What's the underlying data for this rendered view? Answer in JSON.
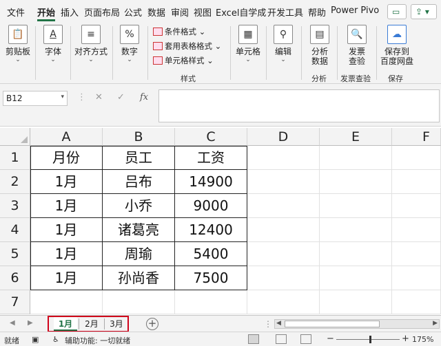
{
  "ribbon_tabs": [
    "文件",
    "开始",
    "插入",
    "页面布局",
    "公式",
    "数据",
    "审阅",
    "视图",
    "Excel自学成",
    "开发工具",
    "帮助",
    "Power Pivo"
  ],
  "active_tab": "开始",
  "ribbon": {
    "paste": "剪贴板",
    "font": "字体",
    "align": "对齐方式",
    "number": "数字",
    "cond_format": "条件格式",
    "table_format": "套用表格格式",
    "cell_style": "单元格样式",
    "styles_group": "样式",
    "cells": "单元格",
    "edit": "编辑",
    "analyze": "分析",
    "analyze2": "数据",
    "analyze_group": "分析",
    "invoice": "发票",
    "invoice2": "查验",
    "invoice_group": "发票查验",
    "save": "保存到",
    "save2": "百度网盘",
    "save_group": "保存",
    "icon_paste": "clipboard-icon",
    "icon_font": "A",
    "icon_number": "%",
    "icon_fx": "fx"
  },
  "formula_bar": {
    "name_box": "B12",
    "formula": ""
  },
  "columns": [
    "A",
    "B",
    "C",
    "D",
    "E",
    "F"
  ],
  "rows": [
    "1",
    "2",
    "3",
    "4",
    "5",
    "6",
    "7"
  ],
  "table": {
    "headers": [
      "月份",
      "员工",
      "工资"
    ],
    "data": [
      [
        "1月",
        "吕布",
        "14900"
      ],
      [
        "1月",
        "小乔",
        "9000"
      ],
      [
        "1月",
        "诸葛亮",
        "12400"
      ],
      [
        "1月",
        "周瑜",
        "5400"
      ],
      [
        "1月",
        "孙尚香",
        "7500"
      ]
    ]
  },
  "sheets": [
    "1月",
    "2月",
    "3月"
  ],
  "active_sheet": "1月",
  "status": {
    "ready": "就绪",
    "accessibility": "辅助功能: 一切就绪",
    "zoom": "175%"
  },
  "colors": {
    "accent": "#217346",
    "highlight_box": "#d0021b"
  }
}
